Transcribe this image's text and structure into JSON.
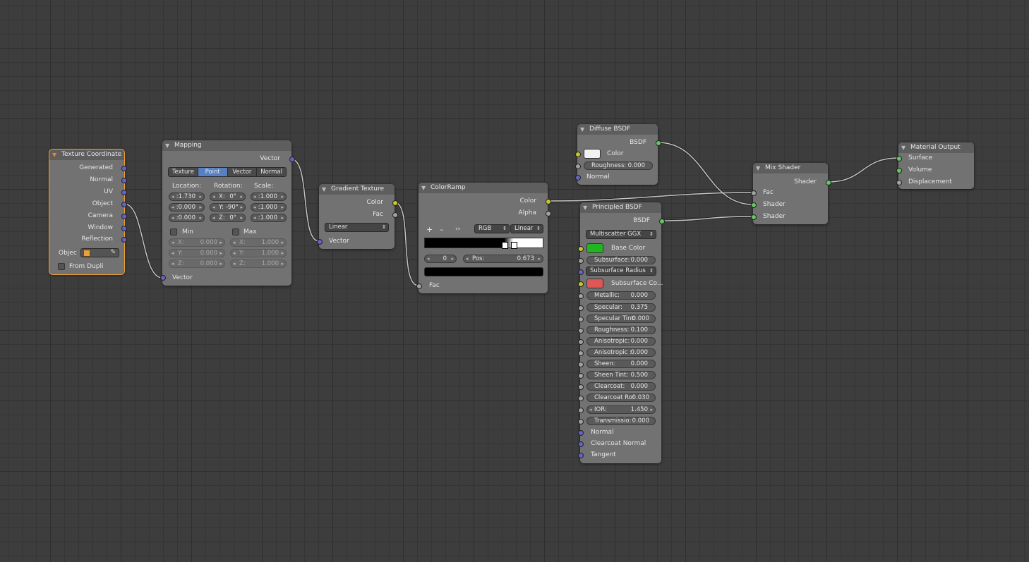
{
  "colors": {
    "vector_socket": "#6363c7",
    "color_socket": "#c7c729",
    "float_socket": "#a1a1a1",
    "shader_socket": "#63c763",
    "selected_tab": "#5680c2",
    "active_outline": "#f0a030",
    "diffuse_color": "#f2f2f2",
    "base_color": "#22b522",
    "subsurface_color": "#e05555"
  },
  "texcoord": {
    "title": "Texture Coordinate",
    "outputs": [
      "Generated",
      "Normal",
      "UV",
      "Object",
      "Camera",
      "Window",
      "Reflection"
    ],
    "object_label": "Objec",
    "from_dupli": "From Dupli",
    "icons": [
      "object-cube-icon",
      "eyedropper-icon"
    ]
  },
  "mapping": {
    "title": "Mapping",
    "out": "Vector",
    "in": "Vector",
    "tabs": [
      "Texture",
      "Point",
      "Vector",
      "Normal"
    ],
    "selected_tab": "Point",
    "loc_h": "Location:",
    "rot_h": "Rotation:",
    "scale_h": "Scale:",
    "location": [
      ":1.730",
      ":0.000",
      ":0.000"
    ],
    "rotation": [
      {
        "l": "X:",
        "v": "0°"
      },
      {
        "l": "Y:",
        "v": "-90°"
      },
      {
        "l": "Z:",
        "v": "0°"
      }
    ],
    "scale": [
      ":1.000",
      ":1.000",
      ":1.000"
    ],
    "min_label": "Min",
    "max_label": "Max",
    "min": [
      {
        "l": "X:",
        "v": "0.000"
      },
      {
        "l": "Y:",
        "v": "0.000"
      },
      {
        "l": "Z:",
        "v": "0.000"
      }
    ],
    "max": [
      {
        "l": "X:",
        "v": "1.000"
      },
      {
        "l": "Y:",
        "v": "1.000"
      },
      {
        "l": "Z:",
        "v": "1.000"
      }
    ]
  },
  "gradient": {
    "title": "Gradient Texture",
    "out_color": "Color",
    "out_fac": "Fac",
    "type": "Linear",
    "in": "Vector"
  },
  "colorramp": {
    "title": "ColorRamp",
    "out_color": "Color",
    "out_alpha": "Alpha",
    "plus": "+",
    "minus": "–",
    "flip": "‹›",
    "mode": "RGB",
    "interp": "Linear",
    "index": "0",
    "pos_label": "Pos:",
    "pos": "0.673",
    "in": "Fac",
    "stops": [
      0.673,
      0.75
    ]
  },
  "diffuse": {
    "title": "Diffuse BSDF",
    "out": "BSDF",
    "color": "Color",
    "roughness_label": "Roughness:",
    "roughness": "0.000",
    "normal": "Normal"
  },
  "principled": {
    "title": "Principled BSDF",
    "out": "BSDF",
    "distribution": "Multiscatter GGX",
    "base_color": "Base Color",
    "subsurface_method": "Subsurface Radius",
    "subsurface_color": "Subsurface Co...",
    "fields": [
      {
        "l": "Subsurface:",
        "v": "0.000"
      },
      {
        "l": "Metallic:",
        "v": "0.000"
      },
      {
        "l": "Specular:",
        "v": "0.375"
      },
      {
        "l": "Specular Tint:",
        "v": "0.000"
      },
      {
        "l": "Roughness:",
        "v": "0.100"
      },
      {
        "l": "Anisotropic:",
        "v": "0.000"
      },
      {
        "l": "Anisotropic :",
        "v": "0.000"
      },
      {
        "l": "Sheen:",
        "v": "0.000"
      },
      {
        "l": "Sheen Tint:",
        "v": "0.500"
      },
      {
        "l": "Clearcoat:",
        "v": "0.000"
      },
      {
        "l": "Clearcoat Ro:",
        "v": "0.030"
      },
      {
        "l": "IOR:",
        "v": "1.450"
      },
      {
        "l": "Transmissio:",
        "v": "0.000"
      }
    ],
    "normal": "Normal",
    "clearcoat_normal": "Clearcoat Normal",
    "tangent": "Tangent"
  },
  "mix": {
    "title": "Mix Shader",
    "out": "Shader",
    "fac": "Fac",
    "shader1": "Shader",
    "shader2": "Shader"
  },
  "output": {
    "title": "Material Output",
    "surface": "Surface",
    "volume": "Volume",
    "displacement": "Displacement"
  }
}
